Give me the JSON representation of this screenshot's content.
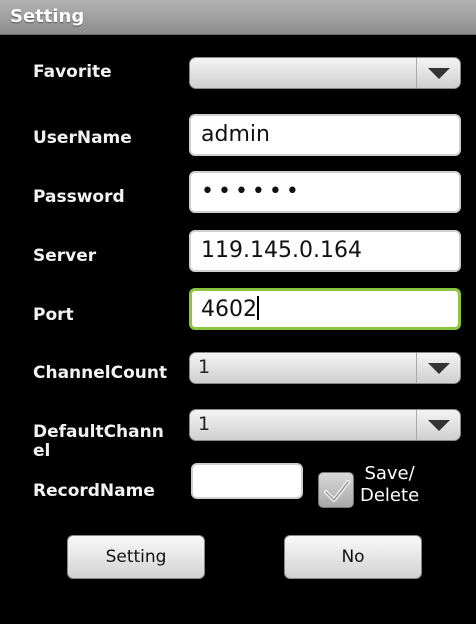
{
  "window": {
    "title": "Setting"
  },
  "form": {
    "favorite": {
      "label": "Favorite",
      "value": ""
    },
    "username": {
      "label": "UserName",
      "value": "admin"
    },
    "password": {
      "label": "Password",
      "value": "••••••"
    },
    "server": {
      "label": "Server",
      "value": "119.145.0.164"
    },
    "port": {
      "label": "Port",
      "value": "4602"
    },
    "channel_count": {
      "label": "ChannelCount",
      "value": "1"
    },
    "default_channel": {
      "label": "DefaultChann\nel",
      "value": "1"
    },
    "record_name": {
      "label": "RecordName",
      "value": ""
    },
    "save_delete": {
      "label": "Save/\nDelete"
    }
  },
  "buttons": {
    "setting": "Setting",
    "no": "No"
  },
  "colors": {
    "titlebar": "#a0a0a0",
    "focus_border": "#8bc53f",
    "background": "#000000"
  }
}
